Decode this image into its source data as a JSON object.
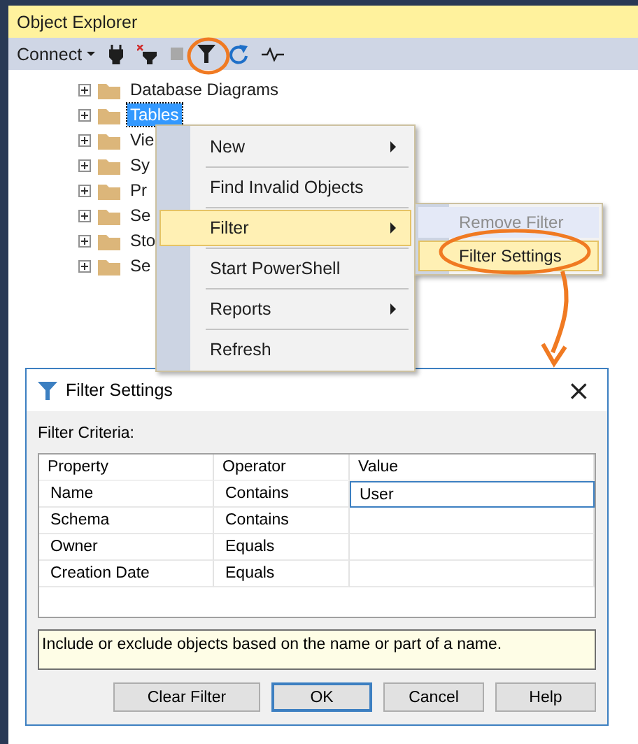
{
  "window": {
    "title": "Object Explorer"
  },
  "toolbar": {
    "connect": "Connect"
  },
  "tree": [
    {
      "label": "Database Diagrams",
      "expanded": false,
      "selected": false
    },
    {
      "label": "Tables",
      "expanded": false,
      "selected": true
    },
    {
      "label": "Vie",
      "expanded": false,
      "selected": false
    },
    {
      "label": "Sy",
      "expanded": false,
      "selected": false
    },
    {
      "label": "Pr",
      "expanded": false,
      "selected": false
    },
    {
      "label": "Se",
      "expanded": false,
      "selected": false
    },
    {
      "label": "Sto",
      "expanded": false,
      "selected": false
    },
    {
      "label": "Se",
      "expanded": false,
      "selected": false
    }
  ],
  "context_menu": [
    {
      "label": "New",
      "submenu": true,
      "selected": false
    },
    {
      "label": "Find Invalid Objects",
      "submenu": false,
      "selected": false
    },
    {
      "label": "Filter",
      "submenu": true,
      "selected": true
    },
    {
      "label": "Start PowerShell",
      "submenu": false,
      "selected": false
    },
    {
      "label": "Reports",
      "submenu": true,
      "selected": false
    },
    {
      "label": "Refresh",
      "submenu": false,
      "selected": false
    }
  ],
  "submenu": [
    {
      "label": "Remove Filter",
      "disabled": true,
      "selected": false
    },
    {
      "label": "Filter Settings",
      "disabled": false,
      "selected": true
    }
  ],
  "dialog": {
    "title": "Filter Settings",
    "close": "×",
    "criteria_label": "Filter Criteria:",
    "columns": [
      "Property",
      "Operator",
      "Value"
    ],
    "rows": [
      {
        "property": "Name",
        "operator": "Contains",
        "value": "User",
        "editing": true
      },
      {
        "property": "Schema",
        "operator": "Contains",
        "editing": false
      },
      {
        "property": "Owner",
        "operator": "Equals",
        "editing": false
      },
      {
        "property": "Creation Date",
        "operator": "Equals",
        "editing": false
      }
    ],
    "description": "Include or exclude objects based on the name or part of a name.",
    "buttons": [
      {
        "label": "Clear Filter",
        "default": false
      },
      {
        "label": "OK",
        "default": true
      },
      {
        "label": "Cancel",
        "default": false
      },
      {
        "label": "Help",
        "default": false
      }
    ]
  }
}
